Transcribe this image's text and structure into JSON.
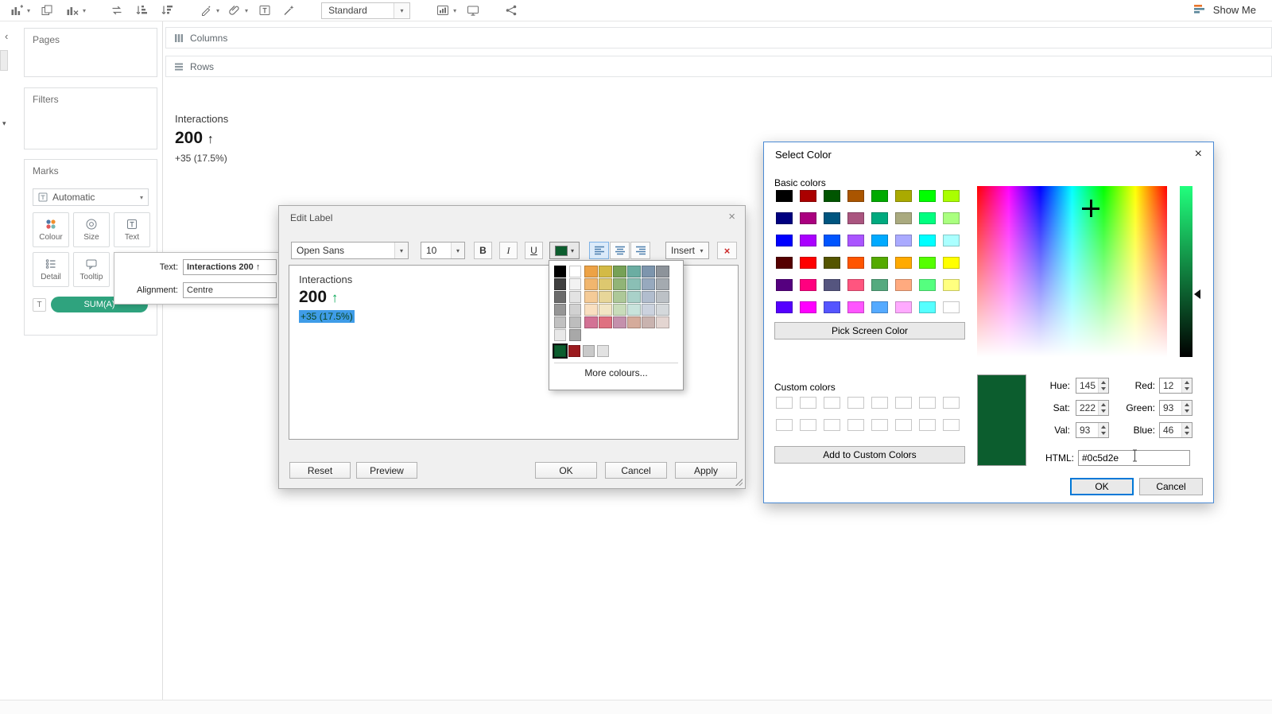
{
  "colors": {
    "current": "#0c5d2e",
    "selection_highlight": "#3f9ce8",
    "preview_arrow_green": "#00a551",
    "pill_green": "#2fa37e",
    "default_button_accent": "#0078d7"
  },
  "toolbar": {
    "view_mode": "Standard",
    "show_me_label": "Show Me",
    "icon_names": [
      "new-worksheet",
      "duplicate",
      "clear-sheet",
      "swap-rows-and-columns",
      "sort-ascending",
      "sort-descending",
      "highlight",
      "group-members",
      "show-mark-labels",
      "fix-axes",
      "show-hide-cards",
      "presentation-mode",
      "share",
      "show-me"
    ]
  },
  "shelves": {
    "columns_label": "Columns",
    "rows_label": "Rows"
  },
  "left_panel": {
    "pages_label": "Pages",
    "filters_label": "Filters",
    "marks_label": "Marks",
    "mark_type": "Automatic",
    "mark_buttons": [
      {
        "label": "Colour"
      },
      {
        "label": "Size"
      },
      {
        "label": "Text"
      },
      {
        "label": "Detail"
      },
      {
        "label": "Tooltip"
      }
    ],
    "pill_label": "SUM(A)"
  },
  "canvas": {
    "title": "Interactions",
    "value": "200",
    "arrow": "↑",
    "delta": "+35 (17.5%)"
  },
  "label_flyout": {
    "text_label": "Text:",
    "text_value": "Interactions 200 ↑",
    "alignment_label": "Alignment:",
    "alignment_value": "Centre"
  },
  "edit_label": {
    "title": "Edit Label",
    "close_glyph": "×",
    "font_name": "Open Sans",
    "font_size": "10",
    "bold_label": "B",
    "italic_label": "I",
    "underline_label": "U",
    "insert_label": "Insert",
    "remove_glyph": "×",
    "preview": {
      "title": "Interactions",
      "value": "200",
      "arrow": "↑",
      "delta": "+35 (17.5%)"
    },
    "reset_label": "Reset",
    "preview_label": "Preview",
    "ok_label": "OK",
    "cancel_label": "Cancel",
    "apply_label": "Apply",
    "color_dropdown": {
      "more_colours_label": "More colours...",
      "selected_color": "#0c5d2e",
      "gray_column": [
        "#000000",
        "#3f3f3f",
        "#6b6b6b",
        "#969696",
        "#c1c1c1",
        "#e8e8e8"
      ],
      "light_column": [
        "#ffffff",
        "#f2f2f2",
        "#e3e3e3",
        "#d1d1d1",
        "#bdbdbd",
        "#a8a8a8"
      ],
      "palette": [
        [
          "#eda245",
          "#d3ba45",
          "#76a156",
          "#6bada2",
          "#7d95ad",
          "#8d939a"
        ],
        [
          "#f1b66e",
          "#ddc86f",
          "#91b477",
          "#8abfb5",
          "#97a9be",
          "#a4aab0"
        ],
        [
          "#f5cb97",
          "#e7d699",
          "#adc898",
          "#a9d1c9",
          "#b1bdce",
          "#bcc1c6"
        ],
        [
          "#f9dfc0",
          "#f1e5c3",
          "#c8dcba",
          "#c8e3dc",
          "#cbd2de",
          "#d4d8db"
        ],
        [
          "#d37295",
          "#df7080",
          "#c490ac",
          "#d5ab9b",
          "#c9b3af",
          "#e3d5d1"
        ]
      ],
      "recent": [
        "#0c5d2e",
        "#9c1b1f",
        "#c9c9c9",
        "#e2e2e2"
      ]
    }
  },
  "select_color": {
    "title": "Select Color",
    "close_glyph": "×",
    "basic_colors_label": "Basic colors",
    "pick_screen_label": "Pick Screen Color",
    "custom_colors_label": "Custom colors",
    "add_custom_label": "Add to Custom Colors",
    "basic_colors": [
      "#000000",
      "#aa0000",
      "#005500",
      "#aa5500",
      "#00aa00",
      "#aaaa00",
      "#00ff00",
      "#aaff00",
      "#00007f",
      "#aa007f",
      "#00557f",
      "#aa557f",
      "#00aa7f",
      "#aaaa7f",
      "#00ff7f",
      "#aaff7f",
      "#0000ff",
      "#aa00ff",
      "#0055ff",
      "#aa55ff",
      "#00aaff",
      "#aaaaff",
      "#00ffff",
      "#aaffff",
      "#550000",
      "#ff0000",
      "#555500",
      "#ff5500",
      "#55aa00",
      "#ffaa00",
      "#55ff00",
      "#ffff00",
      "#55007f",
      "#ff007f",
      "#55557f",
      "#ff557f",
      "#55aa7f",
      "#ffaa7f",
      "#55ff7f",
      "#ffff7f",
      "#5500ff",
      "#ff00ff",
      "#5555ff",
      "#ff55ff",
      "#55aaff",
      "#ffaaff",
      "#55ffff",
      "#ffffff"
    ],
    "custom_colors": [
      "#ffffff",
      "#ffffff",
      "#ffffff",
      "#ffffff",
      "#ffffff",
      "#ffffff",
      "#ffffff",
      "#ffffff",
      "#ffffff",
      "#ffffff",
      "#ffffff",
      "#ffffff",
      "#ffffff",
      "#ffffff",
      "#ffffff",
      "#ffffff"
    ],
    "current_color": "#0c5d2e",
    "hue": {
      "label": "Hue:",
      "value": "145"
    },
    "sat": {
      "label": "Sat:",
      "value": "222"
    },
    "val": {
      "label": "Val:",
      "value": "93"
    },
    "red": {
      "label": "Red:",
      "value": "12"
    },
    "green": {
      "label": "Green:",
      "value": "93"
    },
    "blue": {
      "label": "Blue:",
      "value": "46"
    },
    "html": {
      "label": "HTML:",
      "value": "#0c5d2e"
    },
    "ok_label": "OK",
    "cancel_label": "Cancel"
  }
}
